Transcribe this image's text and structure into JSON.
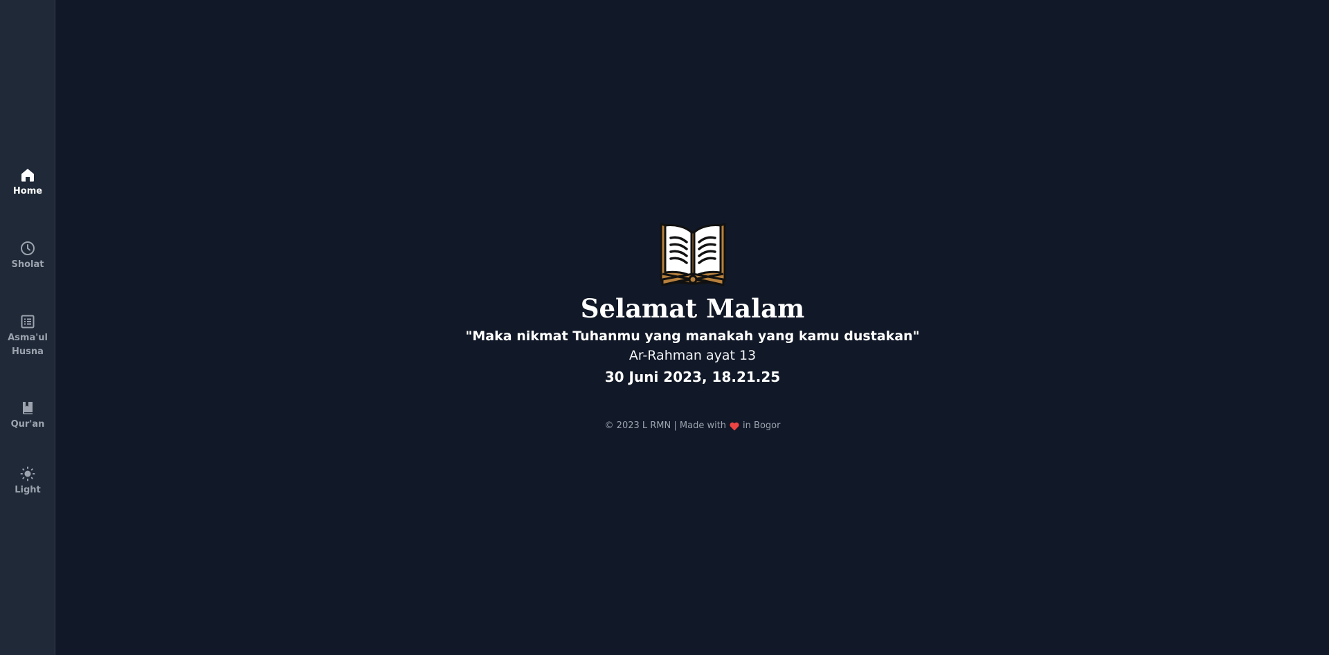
{
  "sidebar": {
    "items": [
      {
        "label": "Home",
        "icon": "home-icon",
        "active": true
      },
      {
        "label": "Sholat",
        "icon": "clock-icon",
        "active": false
      },
      {
        "label": "Asma'ul Husna",
        "icon": "list-icon",
        "active": false
      },
      {
        "label": "Qur'an",
        "icon": "book-icon",
        "active": false
      },
      {
        "label": "Light",
        "icon": "sun-icon",
        "active": false
      }
    ]
  },
  "hero": {
    "greeting": "Selamat Malam",
    "quote": "\"Maka nikmat Tuhanmu yang manakah yang kamu dustakan\"",
    "source": "Ar-Rahman ayat 13",
    "datetime": "30 Juni 2023, 18.21.25"
  },
  "footer": {
    "text_before": "© 2023 L RMN | Made with",
    "text_after": "in Bogor"
  },
  "colors": {
    "background": "#111827",
    "sidebar": "#1f2937",
    "muted_text": "#9ca3af",
    "heart": "#ef4444",
    "book_cover": "#b7803d"
  }
}
